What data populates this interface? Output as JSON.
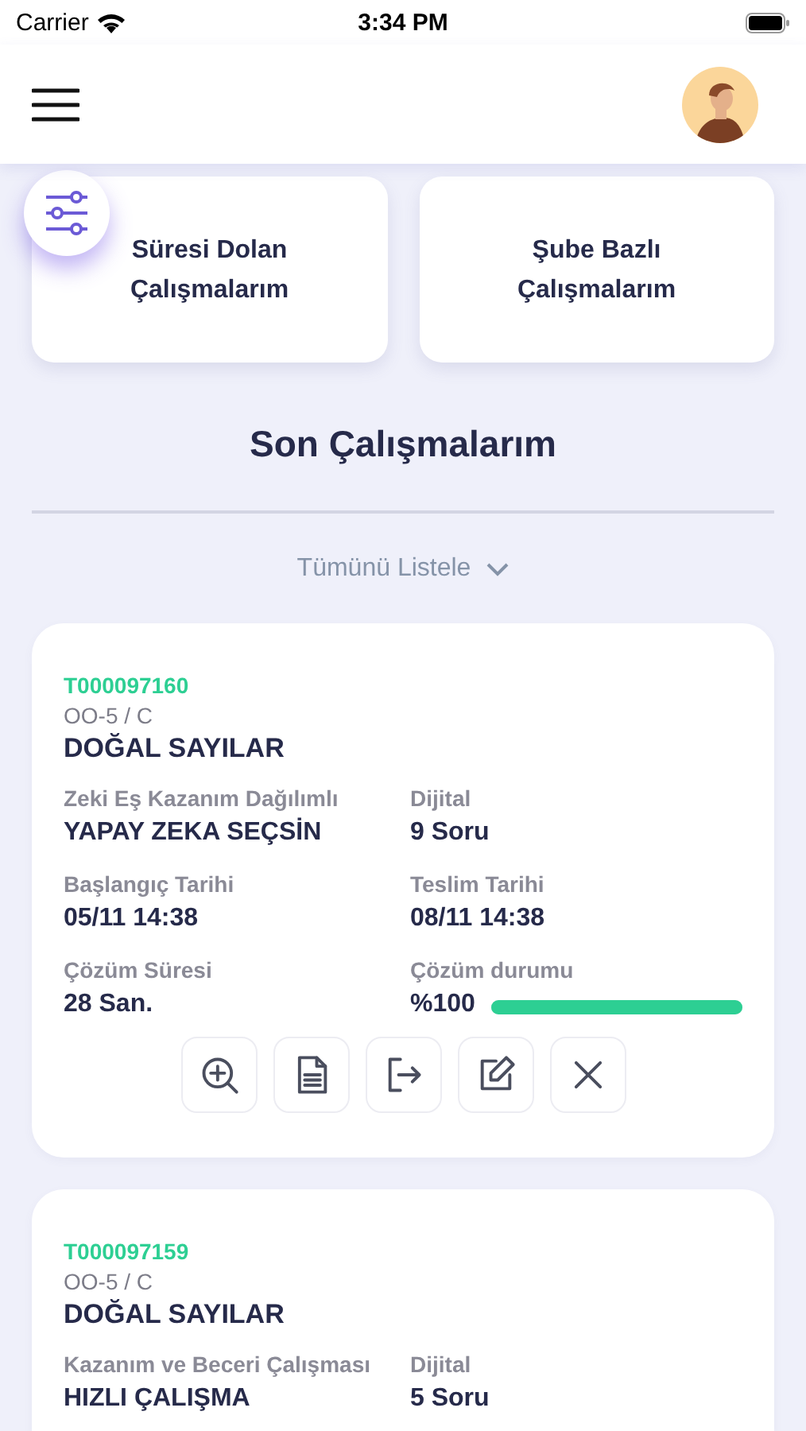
{
  "status_bar": {
    "carrier": "Carrier",
    "time": "3:34 PM"
  },
  "shortcuts": [
    {
      "label": "Süresi Dolan Çalışmalarım"
    },
    {
      "label": "Şube Bazlı Çalışmalarım"
    }
  ],
  "section_title": "Son Çalışmalarım",
  "list_all": "Tümünü Listele",
  "works": [
    {
      "code": "T000097160",
      "class": "OO-5 / C",
      "title": "DOĞAL SAYILAR",
      "actions": true,
      "fields": [
        {
          "kind": "text",
          "label": "Zeki Eş Kazanım Dağılımlı",
          "value": "YAPAY ZEKA SEÇSİN"
        },
        {
          "kind": "text",
          "label": "Dijital",
          "value": "9 Soru"
        },
        {
          "kind": "text",
          "label": "Başlangıç Tarihi",
          "value": "05/11 14:38"
        },
        {
          "kind": "text",
          "label": "Teslim Tarihi",
          "value": "08/11 14:38"
        },
        {
          "kind": "text",
          "label": "Çözüm Süresi",
          "value": "28 San."
        },
        {
          "kind": "progress",
          "label": "Çözüm durumu",
          "value": "%100",
          "level": 1
        }
      ]
    },
    {
      "code": "T000097159",
      "class": "OO-5 / C",
      "title": "DOĞAL SAYILAR",
      "actions": false,
      "fields": [
        {
          "kind": "text",
          "label": "Kazanım ve Beceri Çalışması",
          "value": "HIZLI ÇALIŞMA"
        },
        {
          "kind": "text",
          "label": "Dijital",
          "value": "5 Soru"
        }
      ]
    }
  ]
}
